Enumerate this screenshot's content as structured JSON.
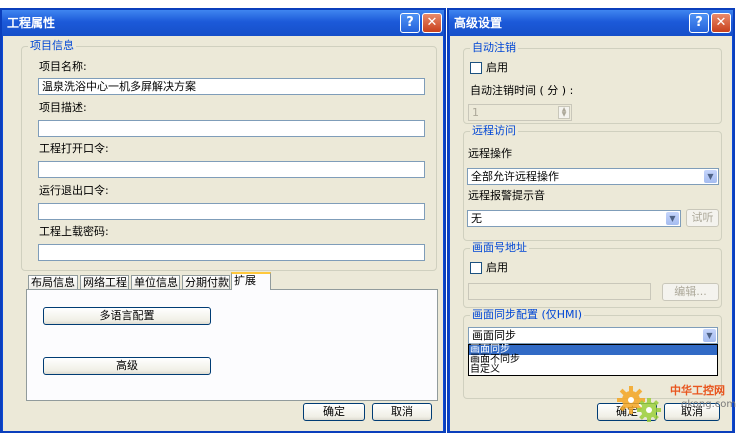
{
  "left_window": {
    "title": "工程属性",
    "help_symbol": "?",
    "close_symbol": "✕",
    "project_group": {
      "legend": "项目信息",
      "name_label": "项目名称:",
      "name_value": "温泉洗浴中心一机多屏解决方案",
      "desc_label": "项目描述:",
      "desc_value": "",
      "open_pwd_label": "工程打开口令:",
      "exit_pwd_label": "运行退出口令:",
      "upload_pwd_label": "工程上载密码:"
    },
    "tabs": [
      {
        "label": "布局信息"
      },
      {
        "label": "网络工程"
      },
      {
        "label": "单位信息"
      },
      {
        "label": "分期付款"
      },
      {
        "label": "扩展"
      }
    ],
    "multilang_button": "多语言配置",
    "advanced_button": "高级",
    "ok_button": "确定",
    "cancel_button": "取消"
  },
  "right_window": {
    "title": "高级设置",
    "help_symbol": "?",
    "close_symbol": "✕",
    "auto_logout": {
      "legend": "自动注销",
      "enable_label": "启用",
      "time_label": "自动注销时间 ( 分 ) :",
      "time_value": "1"
    },
    "remote_access": {
      "legend": "远程访问",
      "operation_label": "远程操作",
      "operation_value": "全部允许远程操作",
      "alarm_label": "远程报警提示音",
      "alarm_value": "无",
      "test_button": "试听"
    },
    "screen_address": {
      "legend": "画面号地址",
      "enable_label": "启用",
      "edit_button": "编辑..."
    },
    "screen_sync": {
      "legend": "画面同步配置 (仅HMI)",
      "selected_value": "画面同步",
      "options": [
        "画面同步",
        "画面不同步",
        "自定义"
      ]
    },
    "ok_button": "确定",
    "cancel_button": "取消"
  },
  "watermark": {
    "brand": "中华工控网",
    "url": "gkong.com"
  }
}
